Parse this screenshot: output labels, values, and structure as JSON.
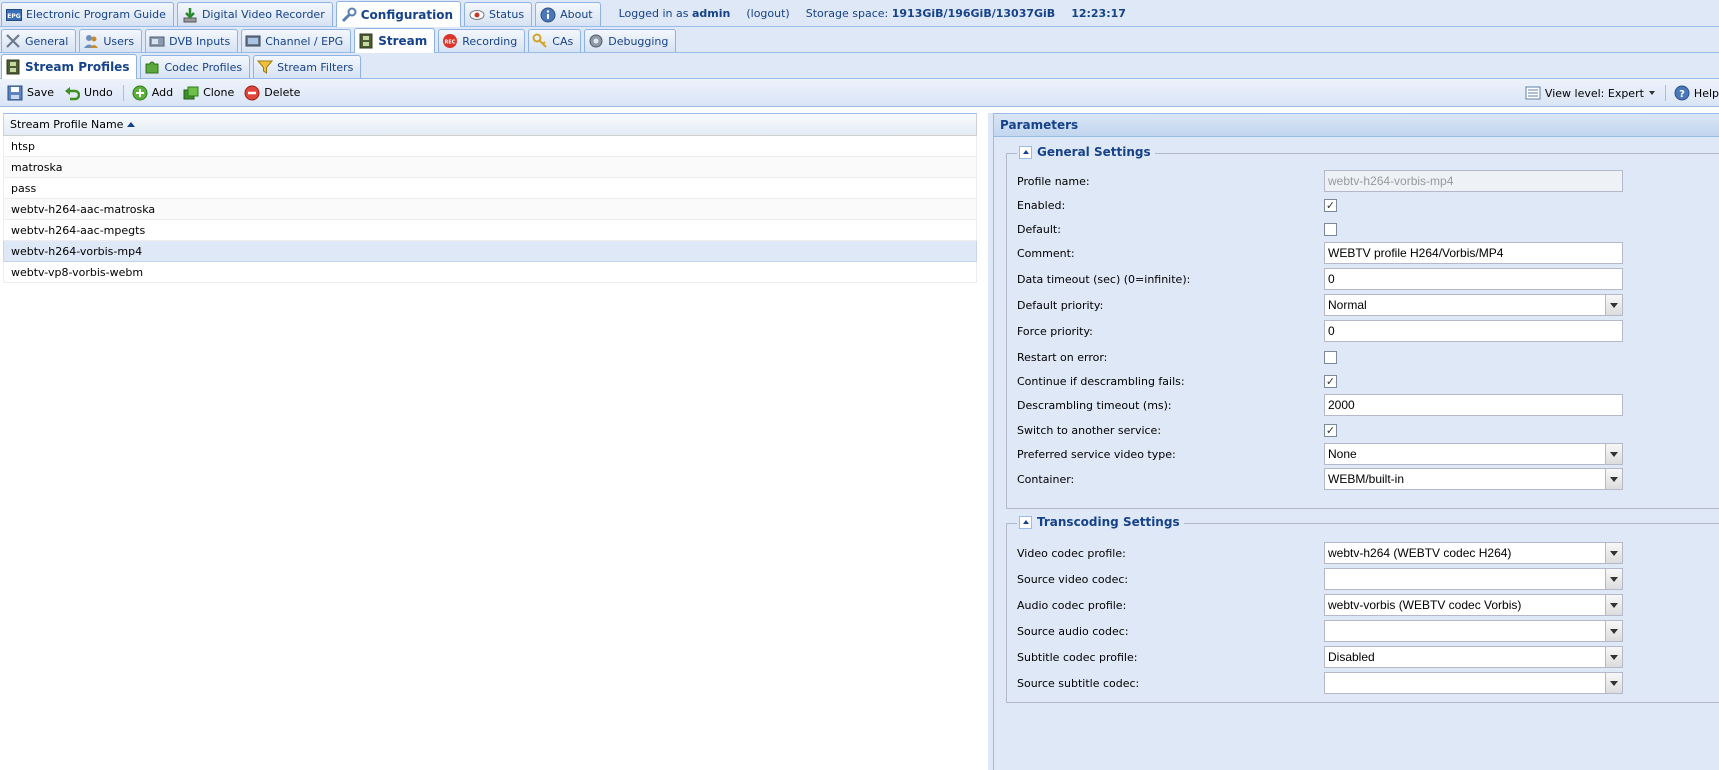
{
  "top_tabs": [
    {
      "label": "Electronic Program Guide",
      "icon": "epg-icon"
    },
    {
      "label": "Digital Video Recorder",
      "icon": "dvr-icon"
    },
    {
      "label": "Configuration",
      "icon": "wrench-icon",
      "active": true
    },
    {
      "label": "Status",
      "icon": "eye-icon"
    },
    {
      "label": "About",
      "icon": "info-icon"
    }
  ],
  "session": {
    "logged_in_prefix": "Logged in as",
    "user": "admin",
    "logout": "(logout)",
    "storage_label": "Storage space:",
    "storage_value": "1913GiB/196GiB/13037GiB",
    "clock": "12:23:17"
  },
  "config_tabs": [
    {
      "label": "General",
      "icon": "tools-icon"
    },
    {
      "label": "Users",
      "icon": "users-icon"
    },
    {
      "label": "DVB Inputs",
      "icon": "dvb-icon"
    },
    {
      "label": "Channel / EPG",
      "icon": "tv-icon"
    },
    {
      "label": "Stream",
      "icon": "film-icon",
      "active": true
    },
    {
      "label": "Recording",
      "icon": "rec-icon"
    },
    {
      "label": "CAs",
      "icon": "key-icon"
    },
    {
      "label": "Debugging",
      "icon": "bug-icon"
    }
  ],
  "stream_tabs": [
    {
      "label": "Stream Profiles",
      "icon": "film-icon",
      "active": true
    },
    {
      "label": "Codec Profiles",
      "icon": "puzzle-icon"
    },
    {
      "label": "Stream Filters",
      "icon": "filter-icon"
    }
  ],
  "toolbar": {
    "save": "Save",
    "undo": "Undo",
    "add": "Add",
    "clone": "Clone",
    "delete": "Delete",
    "view_level": "View level: Expert",
    "help": "Help"
  },
  "grid": {
    "column": "Stream Profile Name",
    "rows": [
      "htsp",
      "matroska",
      "pass",
      "webtv-h264-aac-matroska",
      "webtv-h264-aac-mpegts",
      "webtv-h264-vorbis-mp4",
      "webtv-vp8-vorbis-webm"
    ],
    "selected_index": 5
  },
  "params": {
    "title": "Parameters",
    "general": {
      "legend": "General Settings",
      "profile_name": {
        "label": "Profile name:",
        "value": "webtv-h264-vorbis-mp4"
      },
      "enabled": {
        "label": "Enabled:",
        "checked": true
      },
      "default": {
        "label": "Default:",
        "checked": false
      },
      "comment": {
        "label": "Comment:",
        "value": "WEBTV profile H264/Vorbis/MP4"
      },
      "data_timeout": {
        "label": "Data timeout (sec) (0=infinite):",
        "value": "0"
      },
      "default_priority": {
        "label": "Default priority:",
        "value": "Normal"
      },
      "force_priority": {
        "label": "Force priority:",
        "value": "0"
      },
      "restart_on_error": {
        "label": "Restart on error:",
        "checked": false
      },
      "continue_descramble": {
        "label": "Continue if descrambling fails:",
        "checked": true
      },
      "descramble_timeout": {
        "label": "Descrambling timeout (ms):",
        "value": "2000"
      },
      "switch_service": {
        "label": "Switch to another service:",
        "checked": true
      },
      "preferred_video_type": {
        "label": "Preferred service video type:",
        "value": "None"
      },
      "container": {
        "label": "Container:",
        "value": "WEBM/built-in"
      }
    },
    "transcoding": {
      "legend": "Transcoding Settings",
      "video_codec_profile": {
        "label": "Video codec profile:",
        "value": "webtv-h264 (WEBTV codec H264)"
      },
      "source_video_codec": {
        "label": "Source video codec:",
        "value": ""
      },
      "audio_codec_profile": {
        "label": "Audio codec profile:",
        "value": "webtv-vorbis (WEBTV codec Vorbis)"
      },
      "source_audio_codec": {
        "label": "Source audio codec:",
        "value": ""
      },
      "subtitle_codec_profile": {
        "label": "Subtitle codec profile:",
        "value": "Disabled"
      },
      "source_subtitle_codec": {
        "label": "Source subtitle codec:",
        "value": ""
      }
    }
  }
}
